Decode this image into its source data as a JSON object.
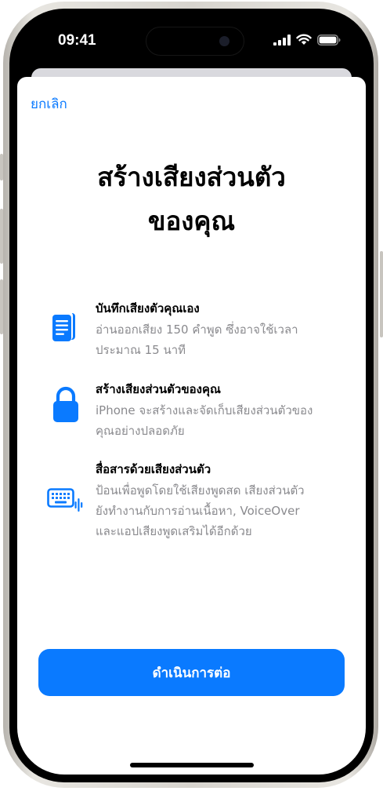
{
  "status_bar": {
    "time": "09:41"
  },
  "nav": {
    "cancel_label": "ยกเลิก"
  },
  "title": {
    "line1": "สร้างเสียงส่วนตัว",
    "line2": "ของคุณ"
  },
  "features": [
    {
      "icon": "document-icon",
      "title": "บันทึกเสียงตัวคุณเอง",
      "desc_line1": "อ่านออกเสียง 150 คำพูด ซึ่งอาจใช้เวลา",
      "desc_line2": "ประมาณ 15 นาที"
    },
    {
      "icon": "lock-icon",
      "title": "สร้างเสียงส่วนตัวของคุณ",
      "desc_line1": "iPhone จะสร้างและจัดเก็บเสียงส่วนตัวของ",
      "desc_line2": "คุณอย่างปลอดภัย"
    },
    {
      "icon": "keyboard-waveform-icon",
      "title": "สื่อสารด้วยเสียงส่วนตัว",
      "desc_line1": "ป้อนเพื่อพูดโดยใช้เสียงพูดสด เสียงส่วนตัว",
      "desc_line2": "ยังทำงานกับการอ่านเนื้อหา, VoiceOver",
      "desc_line3": "และแอปเสียงพูดเสริมได้อีกด้วย"
    }
  ],
  "continue_label": "ดำเนินการต่อ",
  "colors": {
    "accent": "#0a7aff",
    "secondary_text": "#8a8a8e"
  }
}
